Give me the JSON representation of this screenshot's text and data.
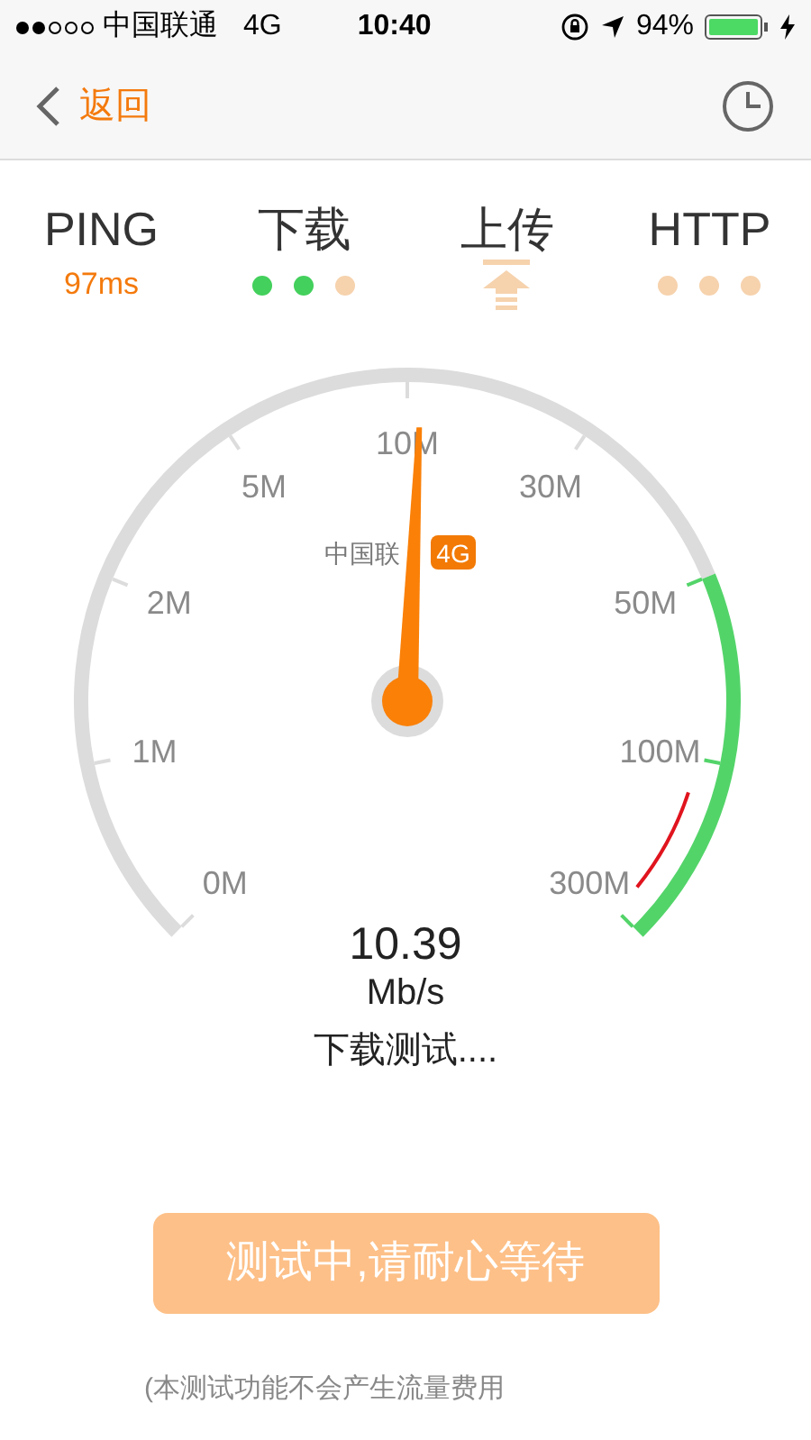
{
  "status_bar": {
    "signal": [
      {
        "filled": true
      },
      {
        "filled": true
      },
      {
        "filled": false
      },
      {
        "filled": false
      },
      {
        "filled": false
      }
    ],
    "carrier": "中国联通",
    "network": "4G",
    "time": "10:40",
    "battery": "94%"
  },
  "nav": {
    "back": "返回"
  },
  "tabs": [
    {
      "label": "PING",
      "kind": "value",
      "value": "97ms"
    },
    {
      "label": "下载",
      "kind": "dots",
      "dots": [
        {
          "done": true
        },
        {
          "done": true
        },
        {
          "done": false
        }
      ]
    },
    {
      "label": "上传",
      "kind": "icon"
    },
    {
      "label": "HTTP",
      "kind": "dots",
      "dots": [
        {
          "done": false
        },
        {
          "done": false
        },
        {
          "done": false
        }
      ]
    }
  ],
  "gauge": {
    "ticks": [
      "0M",
      "1M",
      "2M",
      "5M",
      "10M",
      "30M",
      "50M",
      "100M",
      "300M"
    ],
    "carrier": "中国联",
    "network": "4G"
  },
  "reading": {
    "value": "10.39",
    "unit": "Mb/s",
    "status": "下载测试...."
  },
  "button": "测试中,请耐心等待",
  "footnote": "(本测试功能不会产生流量费用"
}
